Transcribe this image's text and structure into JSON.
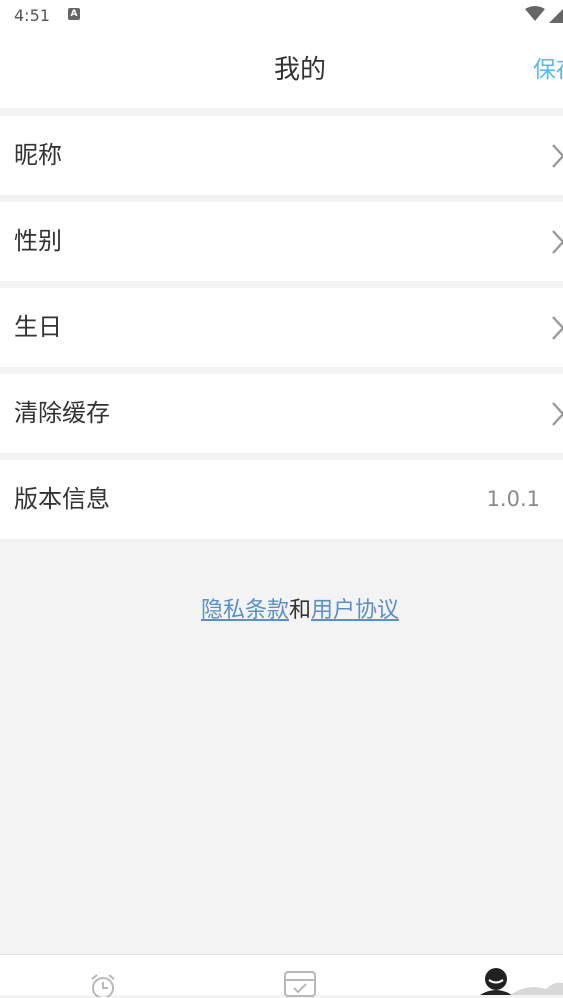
{
  "status_bar": {
    "time": "4:51",
    "notification_badge": "A",
    "icons": [
      "wifi-icon",
      "signal-icon"
    ]
  },
  "header": {
    "title": "我的",
    "save_label": "保存"
  },
  "settings": [
    {
      "label": "昵称",
      "type": "chevron"
    },
    {
      "label": "性别",
      "type": "chevron"
    },
    {
      "label": "生日",
      "type": "chevron"
    },
    {
      "label": "清除缓存",
      "type": "chevron"
    },
    {
      "label": "版本信息",
      "value": "1.0.1"
    }
  ],
  "footer_links": {
    "privacy": "隐私条款",
    "connector": "和",
    "agreement": "用户协议"
  },
  "tabbar": {
    "tabs": [
      {
        "icon": "alarm-clock-icon",
        "active": false
      },
      {
        "icon": "checklist-box-icon",
        "active": false
      },
      {
        "icon": "user-profile-icon",
        "active": true
      }
    ]
  },
  "colors": {
    "accent": "#5ab9e6",
    "link": "#5a90c8",
    "background": "#f3f3f3"
  }
}
